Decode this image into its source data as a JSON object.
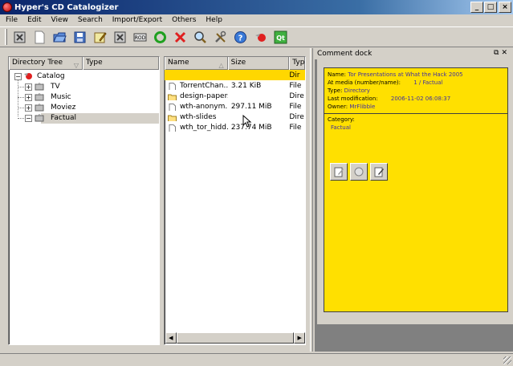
{
  "window": {
    "title": "Hyper's CD Catalogizer",
    "controls": [
      "_",
      "□",
      "×"
    ]
  },
  "menu": [
    "File",
    "Edit",
    "View",
    "Search",
    "Import/Export",
    "Others",
    "Help"
  ],
  "toolbar": {
    "icons": [
      "close-catalog-icon",
      "new-catalog-icon",
      "open-catalog-icon",
      "save-catalog-icon",
      "save-as-icon",
      "close-icon",
      "add-media-icon",
      "rescan-icon",
      "delete-icon",
      "search-icon",
      "tools-icon",
      "help-icon",
      "about-icon",
      "about-qt-icon"
    ]
  },
  "tree": {
    "headers": [
      "Directory Tree",
      "Type"
    ],
    "root": "Catalog",
    "items": [
      "TV",
      "Music",
      "Moviez",
      "Factual"
    ],
    "selected": "Factual"
  },
  "files": {
    "headers": [
      "Name",
      "Size",
      "Typ"
    ],
    "rows": [
      {
        "name": "",
        "size": "",
        "type": "Dir",
        "selected": true,
        "icon": "up-arrow-icon"
      },
      {
        "name": "TorrentChan...",
        "size": "3.21  KiB",
        "type": "File",
        "icon": "file-icon"
      },
      {
        "name": "design-papers",
        "size": "",
        "type": "Dire",
        "icon": "folder-icon"
      },
      {
        "name": "wth-anonym...",
        "size": "297.11  MiB",
        "type": "File",
        "icon": "file-icon"
      },
      {
        "name": "wth-slides",
        "size": "",
        "type": "Dire",
        "icon": "folder-icon"
      },
      {
        "name": "wth_tor_hidd...",
        "size": "237.74  MiB",
        "type": "File",
        "icon": "file-icon"
      }
    ]
  },
  "dock": {
    "title": "Comment dock",
    "name_label": "Name:",
    "name_value": "Tor Presentations at What the Hack 2005",
    "media_label": "At media (number/name):",
    "media_value": "1 / Factual",
    "type_label": "Type:",
    "type_value": "Directory",
    "modified_label": "Last modification:",
    "modified_value": "2006-11-02 06:08:37",
    "owner_label": "Owner:",
    "owner_value": "MrFlibble",
    "category_label": "Category:",
    "category_value": "Factual"
  },
  "colors": {
    "comment_bg": "#ffe000",
    "selection": "#ffd700",
    "value_text": "#4030a0"
  }
}
